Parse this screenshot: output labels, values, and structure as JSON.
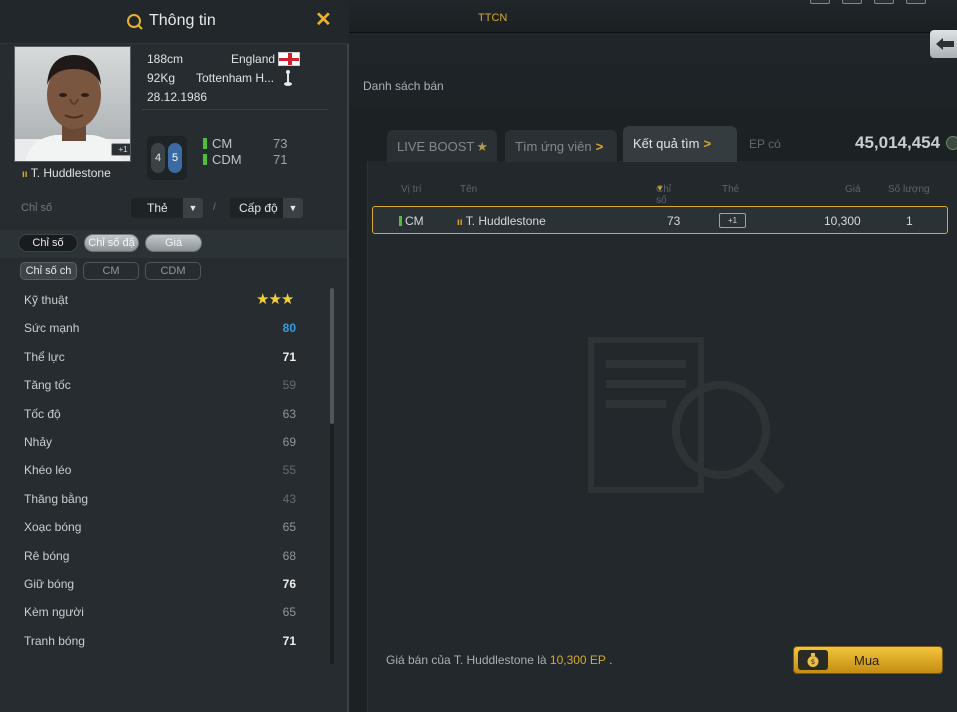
{
  "background": {
    "top_title": "TTCN",
    "sell_list_tab": "Danh sách bán",
    "tabs": [
      {
        "label": "LIVE BOOST",
        "suffix": "★"
      },
      {
        "label": "Tìm ứng viên",
        "suffix": ">"
      },
      {
        "label": "Kết quả tìm",
        "suffix": ">"
      }
    ],
    "ep_label": "EP có",
    "ep_value": "45,014,454",
    "table_headers": {
      "position": "Vị trí",
      "name": "Tên",
      "rating": "Chỉ số",
      "card": "Thẻ",
      "price": "Giá",
      "quantity": "Số lượng"
    },
    "result": {
      "position": "CM",
      "season_icon": "season-icon",
      "name": "T. Huddlestone",
      "rating": "73",
      "card": "+1",
      "price": "10,300",
      "quantity": "1"
    },
    "buy_text_prefix": "Giá bán của T. Huddlestone là ",
    "buy_price": "10,300 EP",
    "buy_text_suffix": ".",
    "buy_button": "Mua",
    "accent_color": "#d9a92c"
  },
  "info_panel": {
    "title": "Thông tin",
    "close": "✕",
    "player": {
      "height": "188cm",
      "weight": "92Kg",
      "birthdate": "28.12.1986",
      "nation": "England",
      "club": "Tottenham H...",
      "name": "T. Huddlestone",
      "portrait_badge": "+1"
    },
    "boost": {
      "left": "4",
      "right": "5"
    },
    "positions": [
      {
        "pos": "CM",
        "value": "73"
      },
      {
        "pos": "CDM",
        "value": "71"
      }
    ],
    "filter": {
      "label": "Chỉ số",
      "card_select": "Thẻ",
      "slash": "/",
      "level_select": "Cấp độ"
    },
    "view_tabs": [
      "Chỉ số",
      "Chỉ số đặ",
      "Giá"
    ],
    "pos_tabs": [
      "Chỉ số ch",
      "CM",
      "CDM"
    ],
    "stats": [
      {
        "name": "Kỹ thuật",
        "value": "★★★",
        "color": "#f4d230",
        "bold": false,
        "type": "stars"
      },
      {
        "name": "Sức mạnh",
        "value": "80",
        "color": "#3d9be0",
        "bold": true
      },
      {
        "name": "Thể lực",
        "value": "71",
        "color": "#eef0f1",
        "bold": true
      },
      {
        "name": "Tăng tốc",
        "value": "59",
        "color": "#626c71",
        "bold": false
      },
      {
        "name": "Tốc độ",
        "value": "63",
        "color": "#8d979b",
        "bold": false
      },
      {
        "name": "Nhảy",
        "value": "69",
        "color": "#8d979b",
        "bold": false
      },
      {
        "name": "Khéo léo",
        "value": "55",
        "color": "#626c71",
        "bold": false
      },
      {
        "name": "Thăng bằng",
        "value": "43",
        "color": "#626c71",
        "bold": false
      },
      {
        "name": "Xoạc bóng",
        "value": "65",
        "color": "#8d979b",
        "bold": false
      },
      {
        "name": "Rê bóng",
        "value": "68",
        "color": "#8d979b",
        "bold": false
      },
      {
        "name": "Giữ bóng",
        "value": "76",
        "color": "#eef0f1",
        "bold": true
      },
      {
        "name": "Kèm người",
        "value": "65",
        "color": "#8d979b",
        "bold": false
      },
      {
        "name": "Tranh bóng",
        "value": "71",
        "color": "#eef0f1",
        "bold": true
      }
    ]
  }
}
